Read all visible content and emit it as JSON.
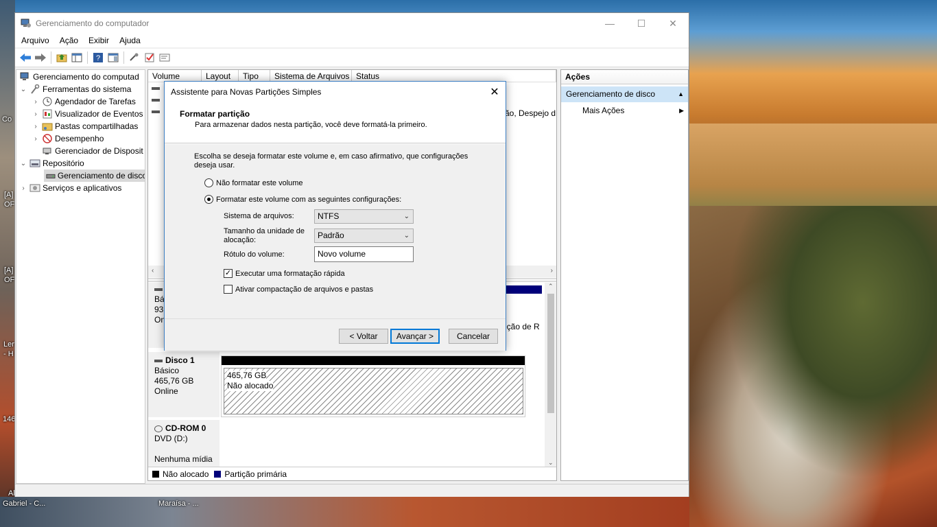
{
  "desktop": {
    "icons": [
      "Co",
      "[A]",
      "OF",
      "[A]",
      "OF",
      "Ler",
      "- H",
      "146",
      "Al",
      "Gabriel - C...",
      "Maraísa - ..."
    ]
  },
  "window": {
    "title": "Gerenciamento do computador",
    "controls": {
      "minimize": "—",
      "maximize": "☐",
      "close": "✕"
    }
  },
  "menu": [
    "Arquivo",
    "Ação",
    "Exibir",
    "Ajuda"
  ],
  "toolbar": [
    "back-icon",
    "forward-icon",
    "up-folder-icon",
    "show-hide-tree-icon",
    "help-icon",
    "properties-icon",
    "connect-icon",
    "check-icon",
    "rescan-icon"
  ],
  "tree": {
    "root": "Gerenciamento do computad",
    "system_tools": "Ferramentas do sistema",
    "task_scheduler": "Agendador de Tarefas",
    "event_viewer": "Visualizador de Eventos",
    "shared_folders": "Pastas compartilhadas",
    "performance": "Desempenho",
    "device_manager": "Gerenciador de Disposit",
    "storage": "Repositório",
    "disk_management": "Gerenciamento de disco",
    "services": "Serviços e aplicativos"
  },
  "volume_list": {
    "columns": [
      "Volume",
      "Layout",
      "Tipo",
      "Sistema de Arquivos",
      "Status"
    ],
    "partial_status": "ão, Despejo d",
    "partial_status2": "ição de R"
  },
  "disks": {
    "disk0": {
      "label_partial": "Bás",
      "size_partial": "93",
      "status_partial": "On"
    },
    "disk1": {
      "name": "Disco 1",
      "type": "Básico",
      "size": "465,76 GB",
      "status": "Online",
      "part_size": "465,76 GB",
      "part_status": "Não alocado"
    },
    "cdrom": {
      "name": "CD-ROM 0",
      "type": "DVD (D:)",
      "media": "Nenhuma mídia"
    }
  },
  "legend": {
    "unallocated": "Não alocado",
    "primary": "Partição primária",
    "unallocated_color": "#000000",
    "primary_color": "#00007a"
  },
  "actions": {
    "header": "Ações",
    "section": "Gerenciamento de disco",
    "more": "Mais Ações"
  },
  "dialog": {
    "title": "Assistente para Novas Partições Simples",
    "heading": "Formatar partição",
    "subheading": "Para armazenar dados nesta partição, você deve formatá-la primeiro.",
    "instruction": "Escolha se deseja formatar este volume e, em caso afirmativo, que configurações deseja usar.",
    "radio_no_format": "Não formatar este volume",
    "radio_format": "Formatar este volume com as seguintes configurações:",
    "fs_label": "Sistema de arquivos:",
    "fs_value": "NTFS",
    "alloc_label": "Tamanho da unidade de alocação:",
    "alloc_value": "Padrão",
    "vol_label": "Rótulo do volume:",
    "vol_value": "Novo volume",
    "quick_format": "Executar uma formatação rápida",
    "compress": "Ativar compactação de arquivos e pastas",
    "quick_format_checked": true,
    "compress_checked": false,
    "back": "< Voltar",
    "next": "Avançar >",
    "cancel": "Cancelar"
  }
}
